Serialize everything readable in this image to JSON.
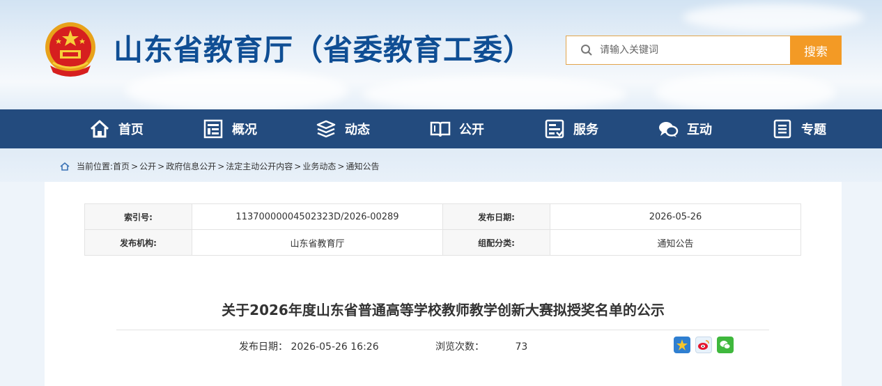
{
  "header": {
    "site_title": "山东省教育厅（省委教育工委）",
    "search": {
      "placeholder": "请输入关键词",
      "button_label": "搜索"
    }
  },
  "nav": {
    "items": [
      {
        "label": "首页",
        "icon": "home-icon"
      },
      {
        "label": "概况",
        "icon": "overview-icon"
      },
      {
        "label": "动态",
        "icon": "news-stack-icon"
      },
      {
        "label": "公开",
        "icon": "open-book-icon"
      },
      {
        "label": "服务",
        "icon": "service-icon"
      },
      {
        "label": "互动",
        "icon": "chat-icon"
      },
      {
        "label": "专题",
        "icon": "document-icon"
      }
    ]
  },
  "breadcrumb": {
    "prefix": "当前位置:",
    "items": [
      "首页",
      "公开",
      "政府信息公开",
      "法定主动公开内容",
      "业务动态",
      "通知公告"
    ],
    "separator": ">"
  },
  "meta": {
    "index_label": "索引号:",
    "index_value": "11370000004502323D/2026-00289",
    "date_label": "发布日期:",
    "date_value": "2026-05-26",
    "org_label": "发布机构:",
    "org_value": "山东省教育厅",
    "category_label": "组配分类:",
    "category_value": "通知公告"
  },
  "article": {
    "title": "关于2026年度山东省普通高等学校教师教学创新大赛拟授奖名单的公示",
    "publish_label": "发布日期：",
    "publish_value": "2026-05-26 16:26",
    "views_label": "浏览次数：",
    "views_value": "73"
  },
  "share": [
    "qzone-icon",
    "weibo-icon",
    "wechat-icon"
  ],
  "colors": {
    "brand_blue": "#0f4e94",
    "nav_bg": "#234b7e",
    "search_button": "#f39a25"
  }
}
